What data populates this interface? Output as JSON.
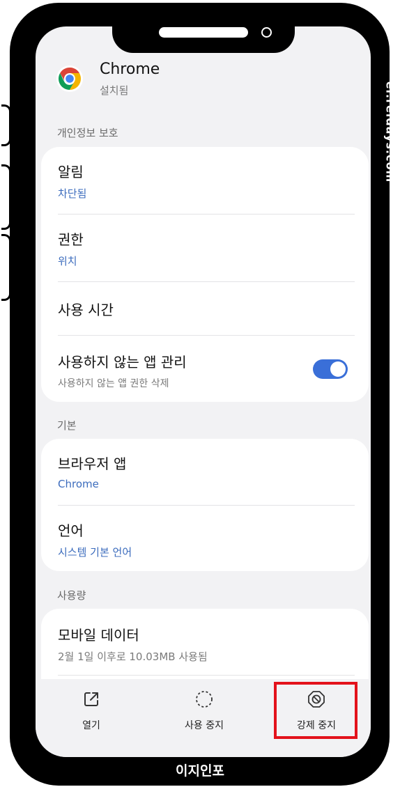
{
  "app": {
    "name": "Chrome",
    "status": "설치됨"
  },
  "sections": {
    "privacy": {
      "title": "개인정보 보호",
      "items": [
        {
          "title": "알림",
          "sub": "차단됨"
        },
        {
          "title": "권한",
          "sub": "위치"
        },
        {
          "title": "사용 시간"
        },
        {
          "title": "사용하지 않는 앱 관리",
          "sub": "사용하지 않는 앱 권한 삭제",
          "toggle": true
        }
      ]
    },
    "basic": {
      "title": "기본",
      "items": [
        {
          "title": "브라우저 앱",
          "sub": "Chrome"
        },
        {
          "title": "언어",
          "sub": "시스템 기본 언어"
        }
      ]
    },
    "usage": {
      "title": "사용량",
      "items": [
        {
          "title": "모바일 데이터",
          "sub": "2월 1일 이후로 10.03MB 사용됨"
        }
      ]
    }
  },
  "bottombar": {
    "open": "열기",
    "disable": "사용 중지",
    "force_stop": "강제 중지"
  },
  "watermark": "ei.reidays.com",
  "brand": "이지인포",
  "colors": {
    "accent": "#3a6fd8",
    "link": "#3c6cbd",
    "highlight": "#e3121b"
  },
  "icons": [
    "chrome-logo-icon",
    "open-external-icon",
    "disable-dashed-circle-icon",
    "force-stop-icon"
  ]
}
